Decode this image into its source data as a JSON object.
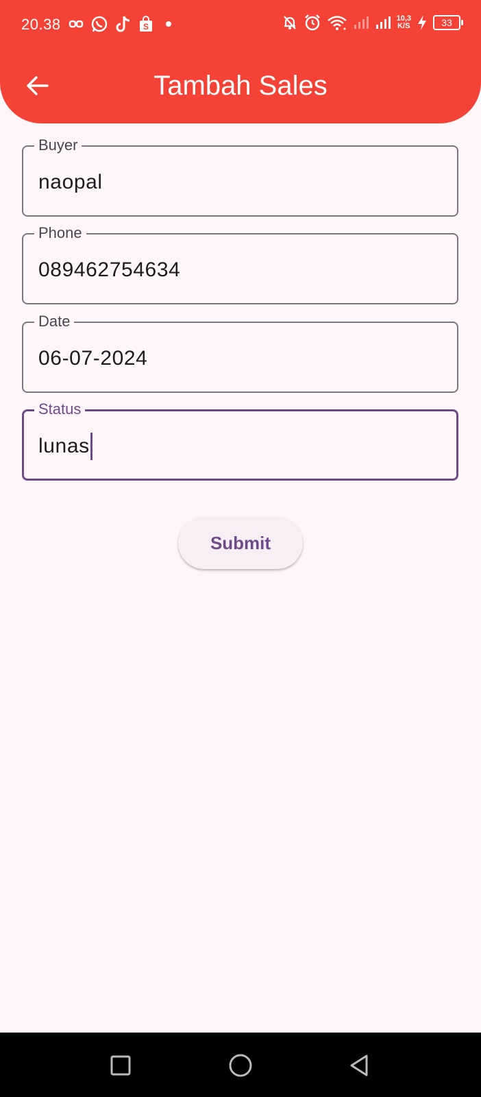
{
  "status_bar": {
    "time": "20.38",
    "net_speed_value": "10,3",
    "net_speed_unit": "K/S",
    "battery": "33",
    "left_icons": [
      "link-icon",
      "whatsapp-icon",
      "tiktok-icon",
      "shopping-bag-icon",
      "dot-icon"
    ],
    "right_icons": [
      "bell-off-icon",
      "alarm-icon",
      "wifi-icon",
      "signal-icon",
      "signal-icon",
      "charging-icon",
      "battery-icon"
    ]
  },
  "app_bar": {
    "title": "Tambah Sales",
    "back_icon": "arrow-back-icon",
    "color": "#F44336"
  },
  "form": {
    "fields": [
      {
        "label": "Buyer",
        "value": "naopal"
      },
      {
        "label": "Phone",
        "value": "089462754634"
      },
      {
        "label": "Date",
        "value": "06-07-2024"
      },
      {
        "label": "Status",
        "value": "lunas",
        "focused": true
      }
    ],
    "submit_label": "Submit",
    "accent_color": "#6F4A8A"
  },
  "nav_bar": {
    "buttons": [
      "recents-square-icon",
      "home-circle-icon",
      "back-triangle-icon"
    ]
  }
}
